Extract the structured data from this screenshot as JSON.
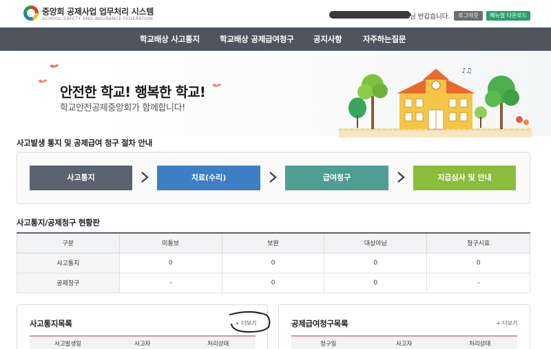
{
  "header": {
    "title": "중앙회 공제사업 업무처리 시스템",
    "subtitle": "SCHOOL SAFETY AND INSURANCE FEDERATION",
    "greeting": "님 반갑습니다.",
    "logout_label": "로그아웃",
    "manual_label": "메뉴얼 다운로드"
  },
  "nav": {
    "items": [
      "학교배상 사고통지",
      "학교배상 공제급여청구",
      "공지사항",
      "자주하는질문"
    ]
  },
  "banner": {
    "title": "안전한 학교! 행복한 학교!",
    "subtitle": "학교안전공제중앙회가 함께합니다!"
  },
  "process": {
    "title": "사고발생 통지 및 공제급여 청구 절차 안내",
    "steps": [
      "사고통지",
      "치료(수리)",
      "급여청구",
      "지급심사 및 안내"
    ],
    "colors": [
      "#5b6370",
      "#3d7ec4",
      "#4e9e93",
      "#8bbd3c"
    ]
  },
  "status": {
    "title": "사고통지/공제청구 현황판",
    "columns": [
      "구분",
      "미통보",
      "보완",
      "대상아님",
      "청구시효"
    ],
    "rows": [
      [
        "사고통지",
        "0",
        "0",
        "0",
        "0"
      ],
      [
        "공제청구",
        "-",
        "0",
        "0",
        "-"
      ]
    ]
  },
  "panels": {
    "left": {
      "title": "사고통지목록",
      "more": "+ 더보기",
      "columns": [
        "사고발생일",
        "사고자",
        "처리상태"
      ]
    },
    "right": {
      "title": "공제급여청구목록",
      "more": "+ 더보기",
      "columns": [
        "청구일",
        "사고자",
        "처리상태"
      ]
    }
  }
}
